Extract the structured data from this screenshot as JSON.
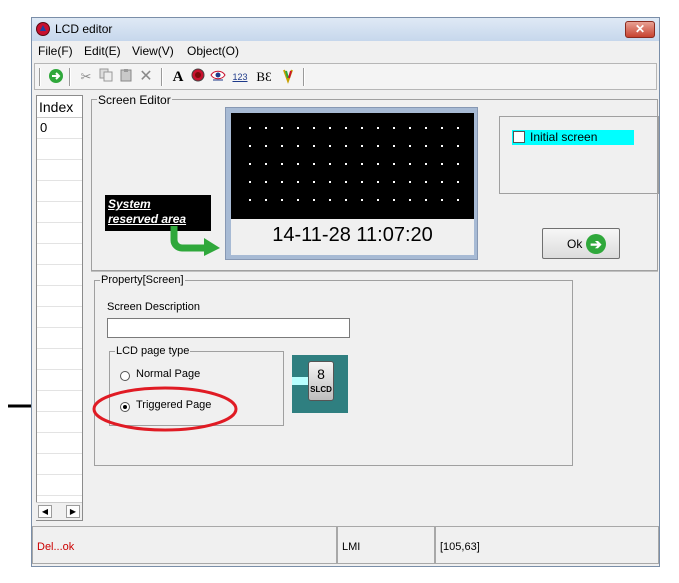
{
  "window": {
    "title": "LCD editor",
    "close_glyph": "✕"
  },
  "menu": [
    {
      "label": "File(F)"
    },
    {
      "label": "Edit(E)"
    },
    {
      "label": "View(V)"
    },
    {
      "label": "Object(O)"
    }
  ],
  "toolbar": {
    "icons": [
      "exit-icon",
      "cut-icon",
      "copy-icon",
      "paste-icon",
      "delete-icon",
      "text-icon",
      "record-icon",
      "eye-icon",
      "numeric-icon",
      "bitmap-icon",
      "pen-icon"
    ],
    "text_glyph": "A",
    "numeric_glyph": "123",
    "bitmap_glyph": "BƐ"
  },
  "index_panel": {
    "header": "Index",
    "rows": [
      "0"
    ]
  },
  "screen_editor": {
    "group_label": "Screen Editor",
    "clock_text": "14-11-28 11:07:20",
    "system_reserved_label_line1": "System",
    "system_reserved_label_line2": "reserved area"
  },
  "initial_screen": {
    "label": "Initial screen",
    "checked": false,
    "highlight_color": "#00ffff"
  },
  "ok_button": {
    "label": "Ok",
    "arrow_glyph": "➔"
  },
  "property": {
    "group_label": "Property[Screen]",
    "description_label": "Screen Description",
    "description_value": "",
    "page_type_label": "LCD page type",
    "options": [
      {
        "label": "Normal  Page",
        "selected": false
      },
      {
        "label": "Triggered Page",
        "selected": true
      }
    ],
    "slcd_digit": "8",
    "slcd_text": "SLCD"
  },
  "status": {
    "message": "Del...ok",
    "message_color": "#cc0000",
    "mode": "LMI",
    "coords": "[105,63]"
  },
  "annotation": {
    "arrow_color": "#000000",
    "ellipse_color": "#e01b24"
  }
}
